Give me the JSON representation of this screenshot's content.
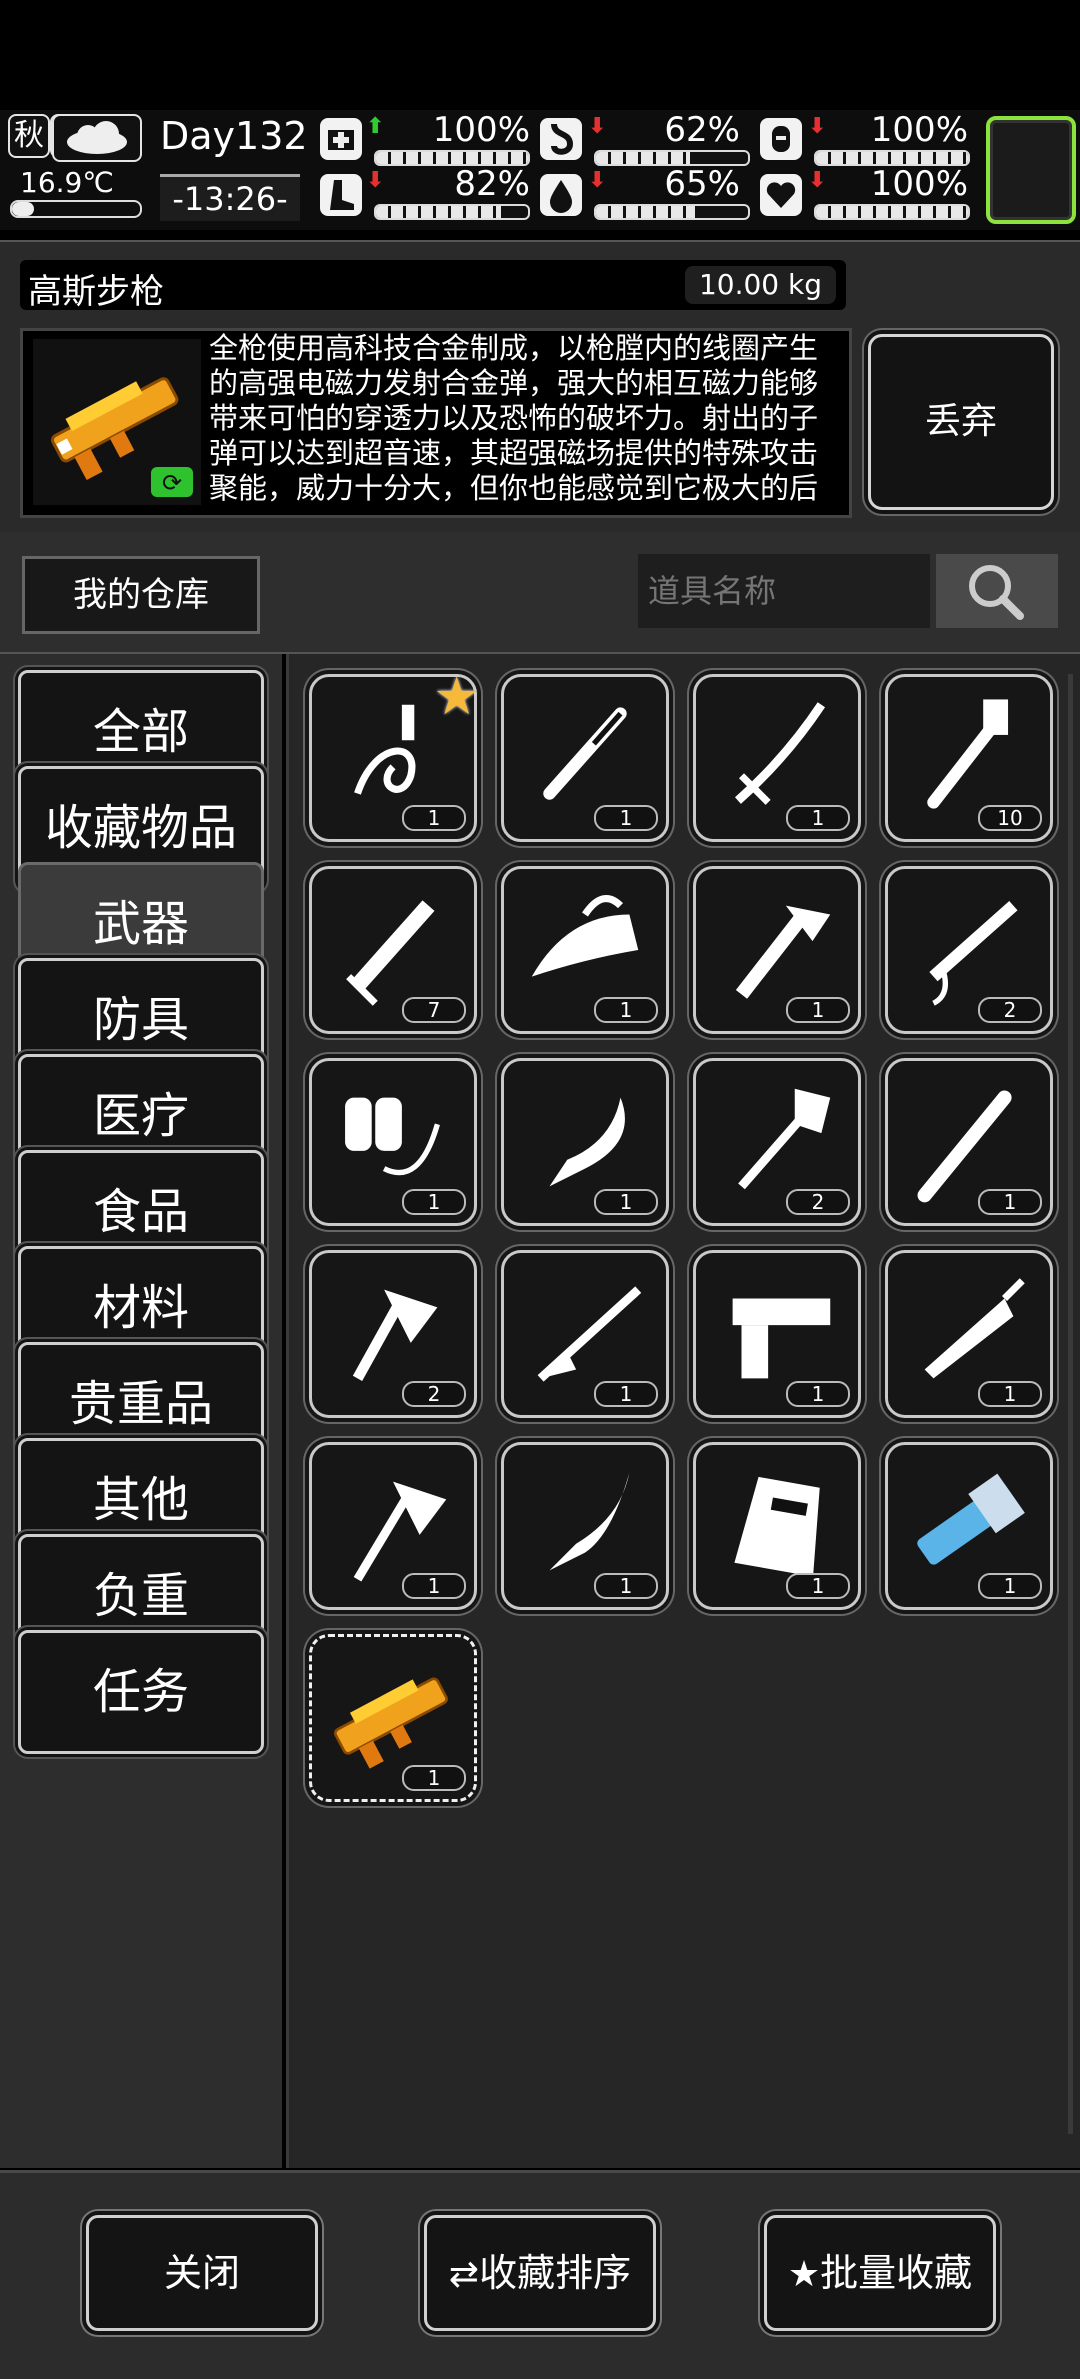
{
  "status": {
    "season": "秋",
    "temperature": "16.9℃",
    "day": "Day132",
    "time": "-13:26-",
    "stats": [
      {
        "name": "health-icon",
        "value": "100%",
        "level": 1.0,
        "trend": "up"
      },
      {
        "name": "stomach-icon",
        "value": "62%",
        "level": 0.62,
        "trend": "down"
      },
      {
        "name": "energy-icon",
        "value": "100%",
        "level": 1.0,
        "trend": "down"
      },
      {
        "name": "stamina-icon",
        "value": "82%",
        "level": 0.82,
        "trend": "down"
      },
      {
        "name": "water-icon",
        "value": "65%",
        "level": 0.65,
        "trend": "down"
      },
      {
        "name": "mood-icon",
        "value": "100%",
        "level": 1.0,
        "trend": "down"
      }
    ]
  },
  "item": {
    "name": "高斯步枪",
    "weight": "10.00 kg",
    "description": "全枪使用高科技合金制成，以枪膛内的线圈产生的高强电磁力发射合金弹，强大的相互磁力能够带来可怕的穿透力以及恐怖的破坏力。射出的子弹可以达到超音速，其超强磁场提供的特殊攻击聚能，威力十分大，但你也能感觉到它极大的后",
    "discard_label": "丢弃"
  },
  "warehouse": {
    "title": "我的仓库",
    "search_placeholder": "道具名称"
  },
  "categories": [
    {
      "label": "全部",
      "active": false
    },
    {
      "label": "收藏物品",
      "active": false
    },
    {
      "label": "武器",
      "active": true
    },
    {
      "label": "防具",
      "active": false
    },
    {
      "label": "医疗",
      "active": false
    },
    {
      "label": "食品",
      "active": false
    },
    {
      "label": "材料",
      "active": false
    },
    {
      "label": "贵重品",
      "active": false
    },
    {
      "label": "其他",
      "active": false
    },
    {
      "label": "负重",
      "active": false
    },
    {
      "label": "任务",
      "active": false
    }
  ],
  "inventory": [
    {
      "icon": "whip-icon",
      "count": "1",
      "favorite": true
    },
    {
      "icon": "screwdriver-icon",
      "count": "1"
    },
    {
      "icon": "katana-icon",
      "count": "1"
    },
    {
      "icon": "pipe-wrench-icon",
      "count": "10"
    },
    {
      "icon": "caulk-gun-icon",
      "count": "7"
    },
    {
      "icon": "iron-icon",
      "count": "1"
    },
    {
      "icon": "multi-tool-axe-icon",
      "count": "1"
    },
    {
      "icon": "nail-gun-icon",
      "count": "2"
    },
    {
      "icon": "flamethrower-icon",
      "count": "1"
    },
    {
      "icon": "kukri-icon",
      "count": "1"
    },
    {
      "icon": "shovel-icon",
      "count": "2"
    },
    {
      "icon": "spiked-bat-icon",
      "count": "1"
    },
    {
      "icon": "tomahawk-icon",
      "count": "2"
    },
    {
      "icon": "rifle-icon",
      "count": "1"
    },
    {
      "icon": "pistol-icon",
      "count": "1"
    },
    {
      "icon": "broadsword-icon",
      "count": "1"
    },
    {
      "icon": "axe-icon",
      "count": "1"
    },
    {
      "icon": "knife-icon",
      "count": "1"
    },
    {
      "icon": "riot-shield-icon",
      "count": "1"
    },
    {
      "icon": "minigun-icon",
      "count": "1"
    },
    {
      "icon": "gauss-rifle-icon",
      "count": "1",
      "selected": true
    }
  ],
  "buttons": {
    "close": "关闭",
    "sort_favorites": "收藏排序",
    "batch_favorite": "批量收藏"
  }
}
